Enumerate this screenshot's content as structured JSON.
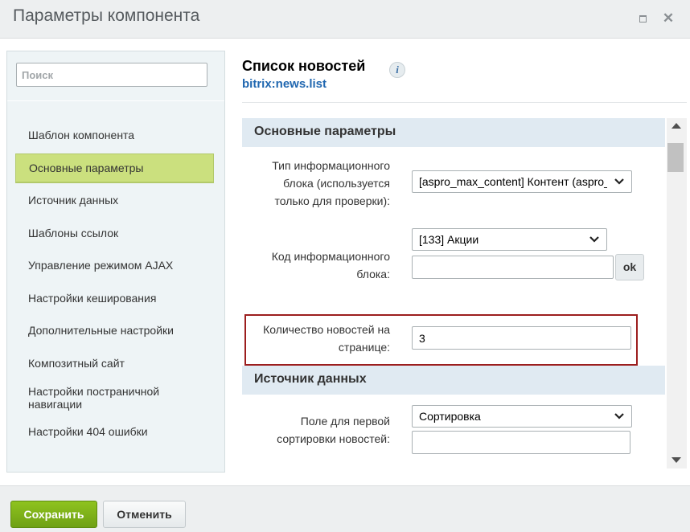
{
  "window": {
    "title": "Параметры компонента",
    "maximize_icon": "maximize-icon",
    "close_icon": "close-icon"
  },
  "sidebar": {
    "search_placeholder": "Поиск",
    "items": [
      {
        "label": "Шаблон компонента",
        "active": false
      },
      {
        "label": "Основные параметры",
        "active": true
      },
      {
        "label": "Источник данных",
        "active": false
      },
      {
        "label": "Шаблоны ссылок",
        "active": false
      },
      {
        "label": "Управление режимом AJAX",
        "active": false
      },
      {
        "label": "Настройки кеширования",
        "active": false
      },
      {
        "label": "Дополнительные настройки",
        "active": false
      },
      {
        "label": "Композитный сайт",
        "active": false
      },
      {
        "label": "Настройки постраничной навигации",
        "active": false
      },
      {
        "label": "Настройки 404 ошибки",
        "active": false
      }
    ]
  },
  "header": {
    "title": "Список новостей",
    "subtitle": "bitrix:news.list",
    "info_icon": "info-icon"
  },
  "sections": {
    "main": "Основные параметры",
    "source": "Источник данных"
  },
  "fields": {
    "iblock_type": {
      "label": "Тип информационного блока (используется только для проверки):",
      "value": "[aspro_max_content] Контент (aspro_max_content)"
    },
    "iblock_code": {
      "label": "Код информационного блока:",
      "select_value": "[133] Акции",
      "input_value": "",
      "ok_label": "ok"
    },
    "news_count": {
      "label": "Количество новостей на странице:",
      "value": "3"
    },
    "sort_field": {
      "label": "Поле для первой сортировки новостей:",
      "select_value": "Сортировка",
      "input_value": ""
    }
  },
  "footer": {
    "save_label": "Сохранить",
    "cancel_label": "Отменить"
  },
  "colors": {
    "active_nav": "#cbe07e",
    "section_header": "#e0eaf2",
    "save_button": "#7ab01a",
    "highlight_border": "#9c1e1e",
    "subtitle_link": "#2067b0"
  }
}
